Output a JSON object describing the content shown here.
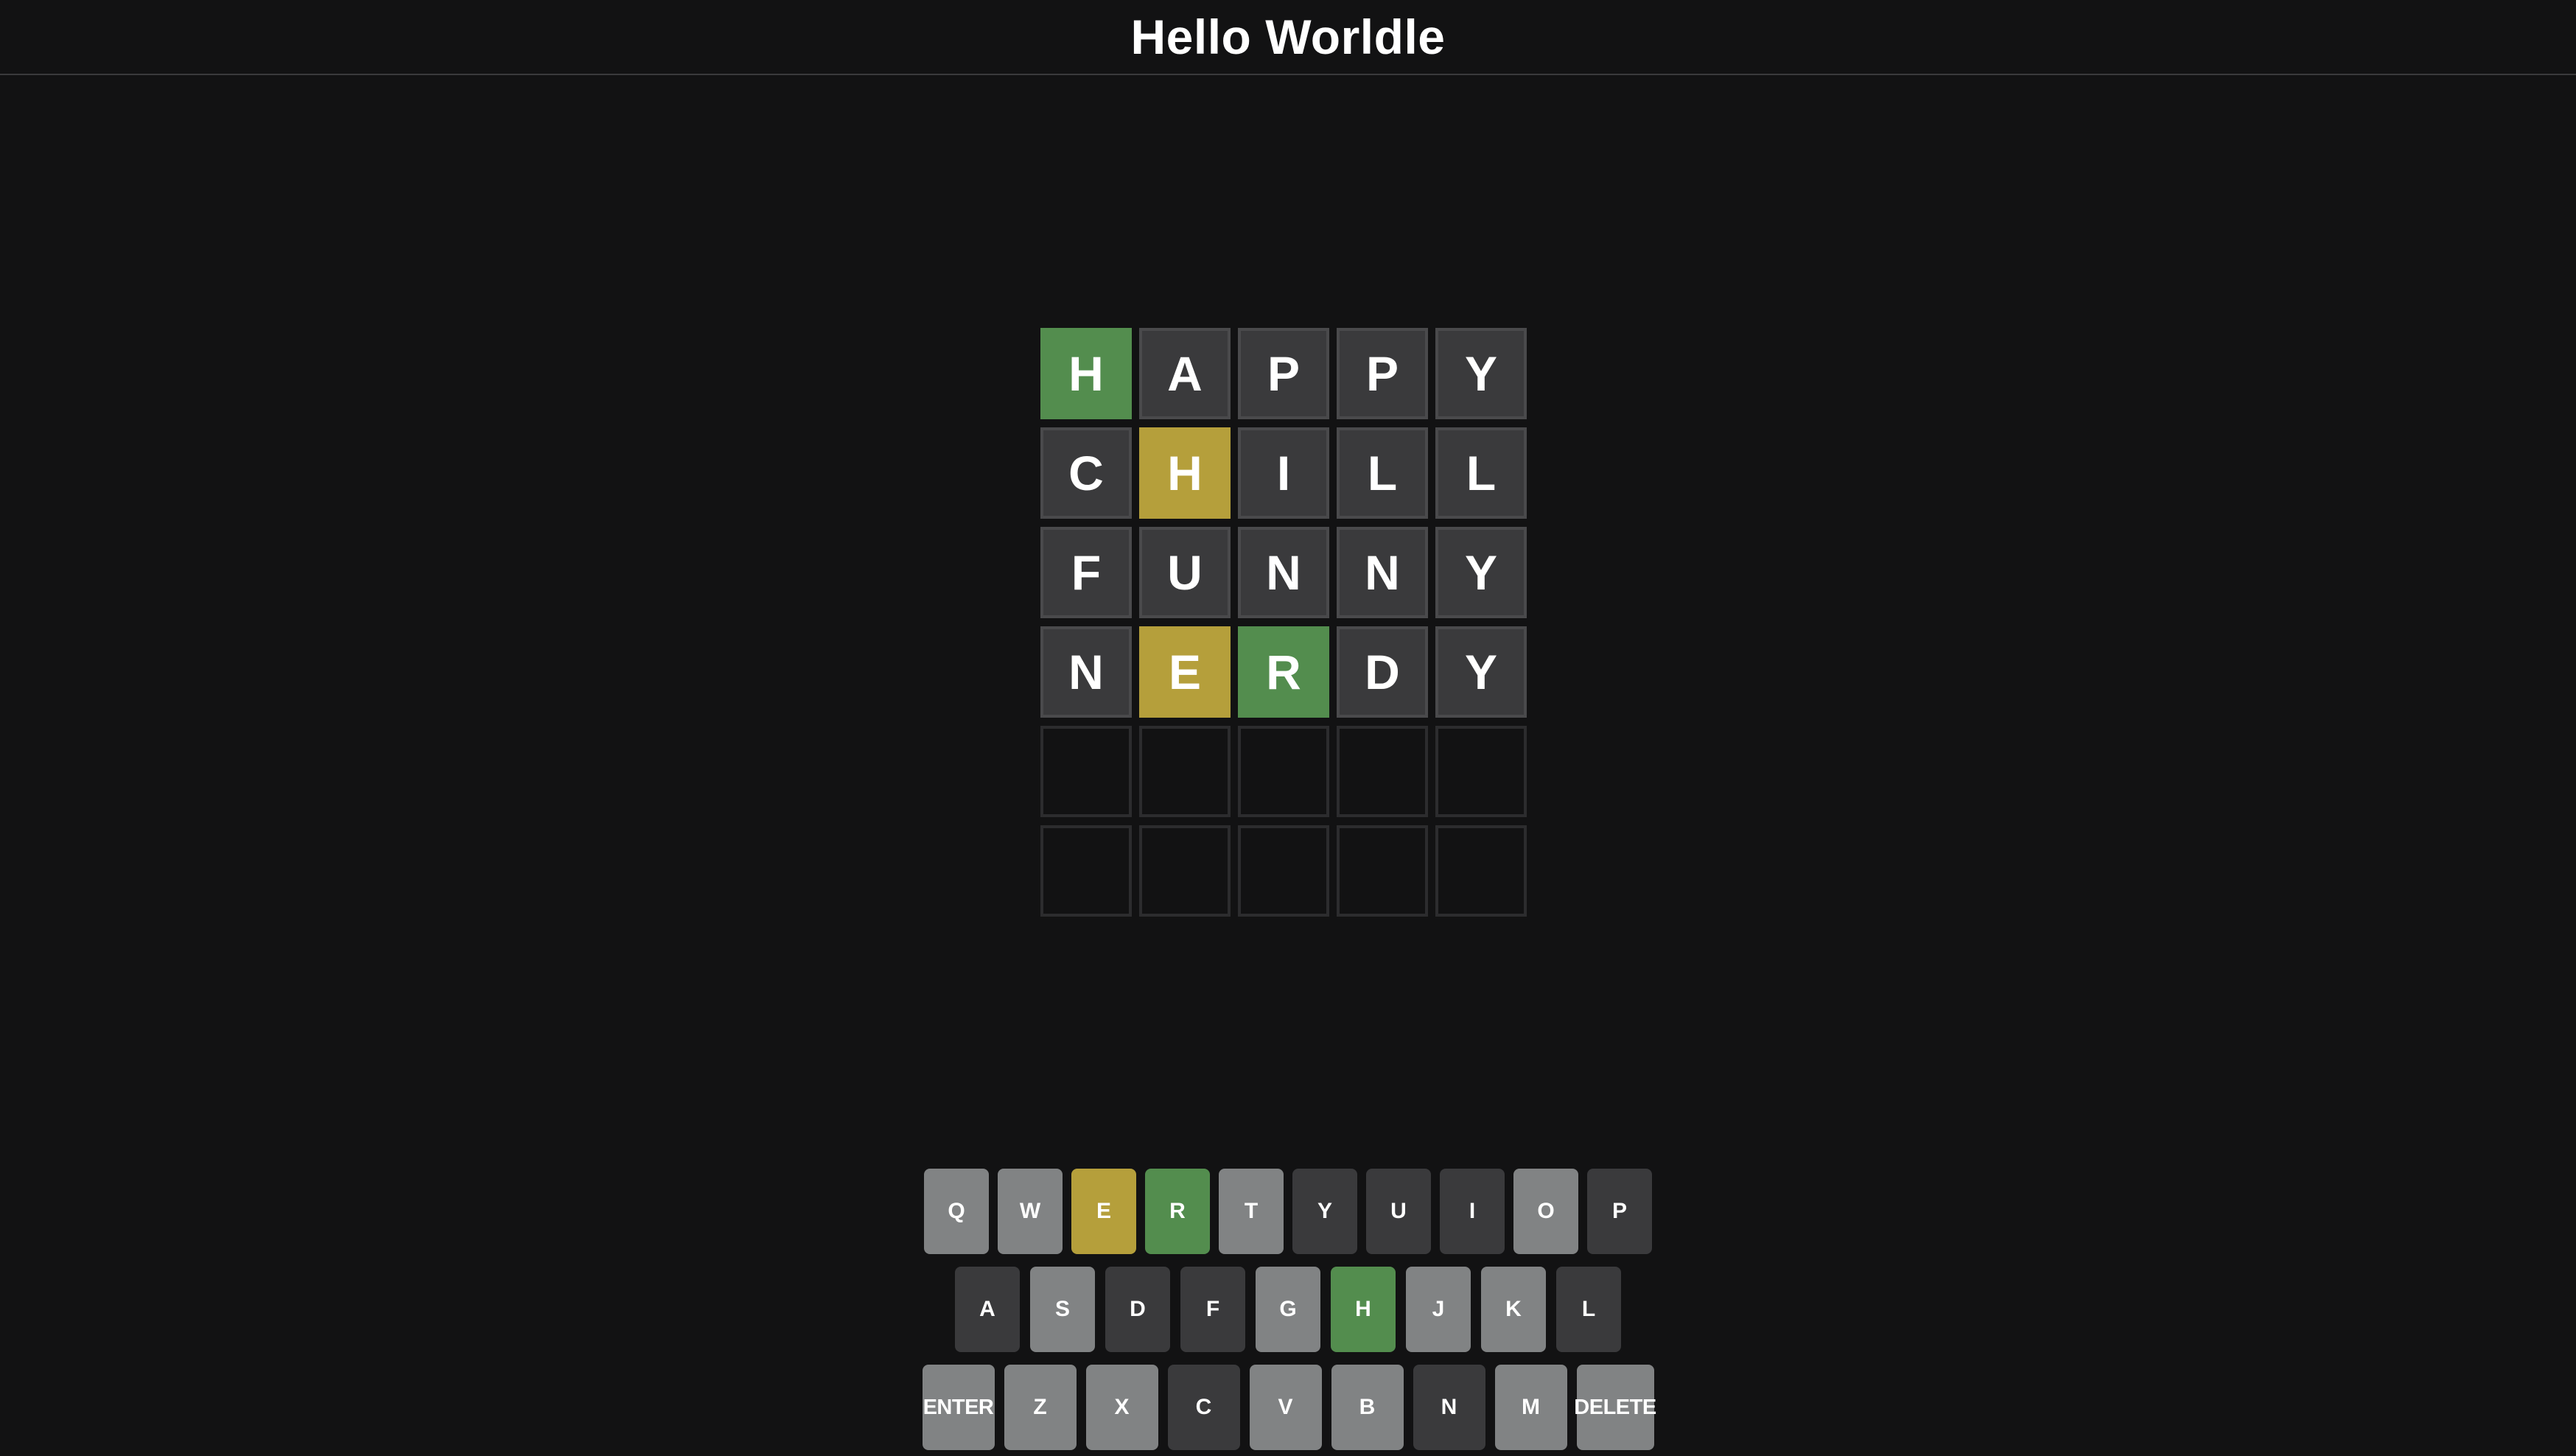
{
  "title": "Hello Worldle",
  "colors": {
    "background": "#121213",
    "correct": "#538d4e",
    "present": "#b59f3b",
    "absent": "#3a3a3c",
    "unused_key": "#818384"
  },
  "board": [
    [
      {
        "l": "H",
        "s": "correct"
      },
      {
        "l": "A",
        "s": "absent"
      },
      {
        "l": "P",
        "s": "absent"
      },
      {
        "l": "P",
        "s": "absent"
      },
      {
        "l": "Y",
        "s": "absent"
      }
    ],
    [
      {
        "l": "C",
        "s": "absent"
      },
      {
        "l": "H",
        "s": "present"
      },
      {
        "l": "I",
        "s": "absent"
      },
      {
        "l": "L",
        "s": "absent"
      },
      {
        "l": "L",
        "s": "absent"
      }
    ],
    [
      {
        "l": "F",
        "s": "absent"
      },
      {
        "l": "U",
        "s": "absent"
      },
      {
        "l": "N",
        "s": "absent"
      },
      {
        "l": "N",
        "s": "absent"
      },
      {
        "l": "Y",
        "s": "absent"
      }
    ],
    [
      {
        "l": "N",
        "s": "absent"
      },
      {
        "l": "E",
        "s": "present"
      },
      {
        "l": "R",
        "s": "correct"
      },
      {
        "l": "D",
        "s": "absent"
      },
      {
        "l": "Y",
        "s": "absent"
      }
    ],
    [
      {
        "l": "",
        "s": "empty"
      },
      {
        "l": "",
        "s": "empty"
      },
      {
        "l": "",
        "s": "empty"
      },
      {
        "l": "",
        "s": "empty"
      },
      {
        "l": "",
        "s": "empty"
      }
    ],
    [
      {
        "l": "",
        "s": "empty"
      },
      {
        "l": "",
        "s": "empty"
      },
      {
        "l": "",
        "s": "empty"
      },
      {
        "l": "",
        "s": "empty"
      },
      {
        "l": "",
        "s": "empty"
      }
    ]
  ],
  "keyboard": [
    [
      {
        "k": "Q",
        "s": "unused"
      },
      {
        "k": "W",
        "s": "unused"
      },
      {
        "k": "E",
        "s": "present"
      },
      {
        "k": "R",
        "s": "correct"
      },
      {
        "k": "T",
        "s": "unused"
      },
      {
        "k": "Y",
        "s": "absent"
      },
      {
        "k": "U",
        "s": "absent"
      },
      {
        "k": "I",
        "s": "absent"
      },
      {
        "k": "O",
        "s": "unused"
      },
      {
        "k": "P",
        "s": "absent"
      }
    ],
    [
      {
        "k": "A",
        "s": "absent"
      },
      {
        "k": "S",
        "s": "unused"
      },
      {
        "k": "D",
        "s": "absent"
      },
      {
        "k": "F",
        "s": "absent"
      },
      {
        "k": "G",
        "s": "unused"
      },
      {
        "k": "H",
        "s": "correct"
      },
      {
        "k": "J",
        "s": "unused"
      },
      {
        "k": "K",
        "s": "unused"
      },
      {
        "k": "L",
        "s": "absent"
      }
    ],
    [
      {
        "k": "ENTER",
        "s": "unused",
        "wide": true
      },
      {
        "k": "Z",
        "s": "unused"
      },
      {
        "k": "X",
        "s": "unused"
      },
      {
        "k": "C",
        "s": "absent"
      },
      {
        "k": "V",
        "s": "unused"
      },
      {
        "k": "B",
        "s": "unused"
      },
      {
        "k": "N",
        "s": "absent"
      },
      {
        "k": "M",
        "s": "unused"
      },
      {
        "k": "DELETE",
        "s": "unused",
        "wide": true
      }
    ]
  ]
}
